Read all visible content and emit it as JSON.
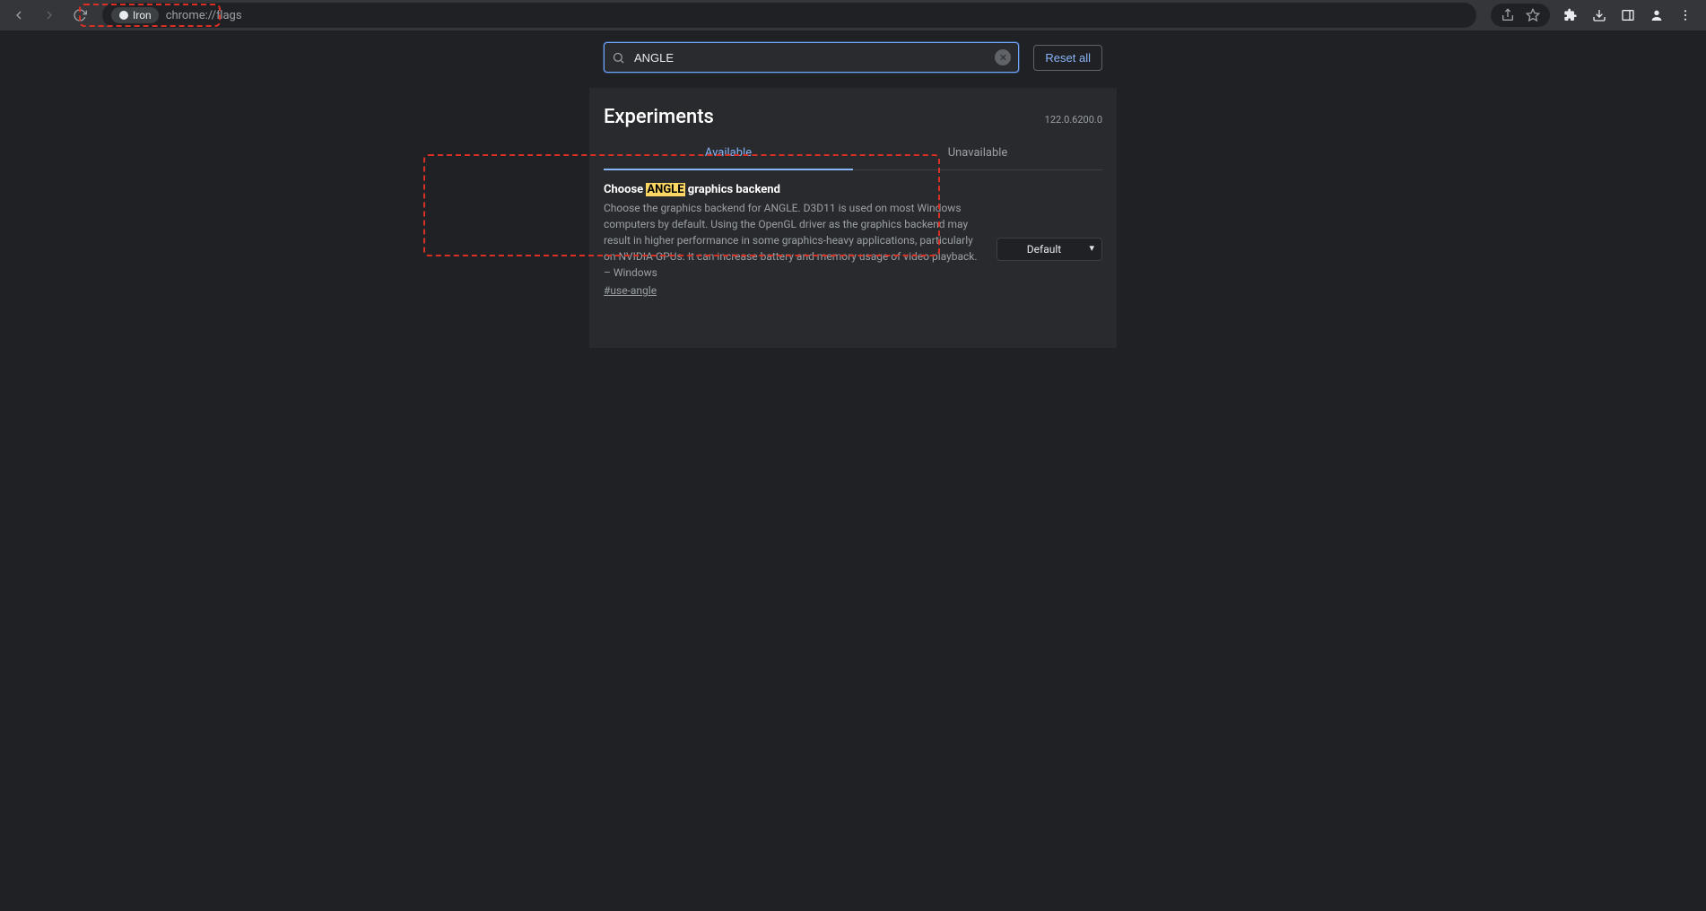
{
  "browser": {
    "chip": "Iron",
    "url": "chrome://flags"
  },
  "search": {
    "value": "ANGLE",
    "reset_label": "Reset all"
  },
  "header": {
    "title": "Experiments",
    "version": "122.0.6200.0"
  },
  "tabs": {
    "available": "Available",
    "unavailable": "Unavailable"
  },
  "flag": {
    "title_pre": "Choose ",
    "title_hl": "ANGLE",
    "title_post": " graphics backend",
    "description": "Choose the graphics backend for ANGLE. D3D11 is used on most Windows computers by default. Using the OpenGL driver as the graphics backend may result in higher performance in some graphics-heavy applications, particularly on NVIDIA GPUs. It can increase battery and memory usage of video playback. – Windows",
    "anchor": "#use-angle",
    "selected": "Default"
  }
}
